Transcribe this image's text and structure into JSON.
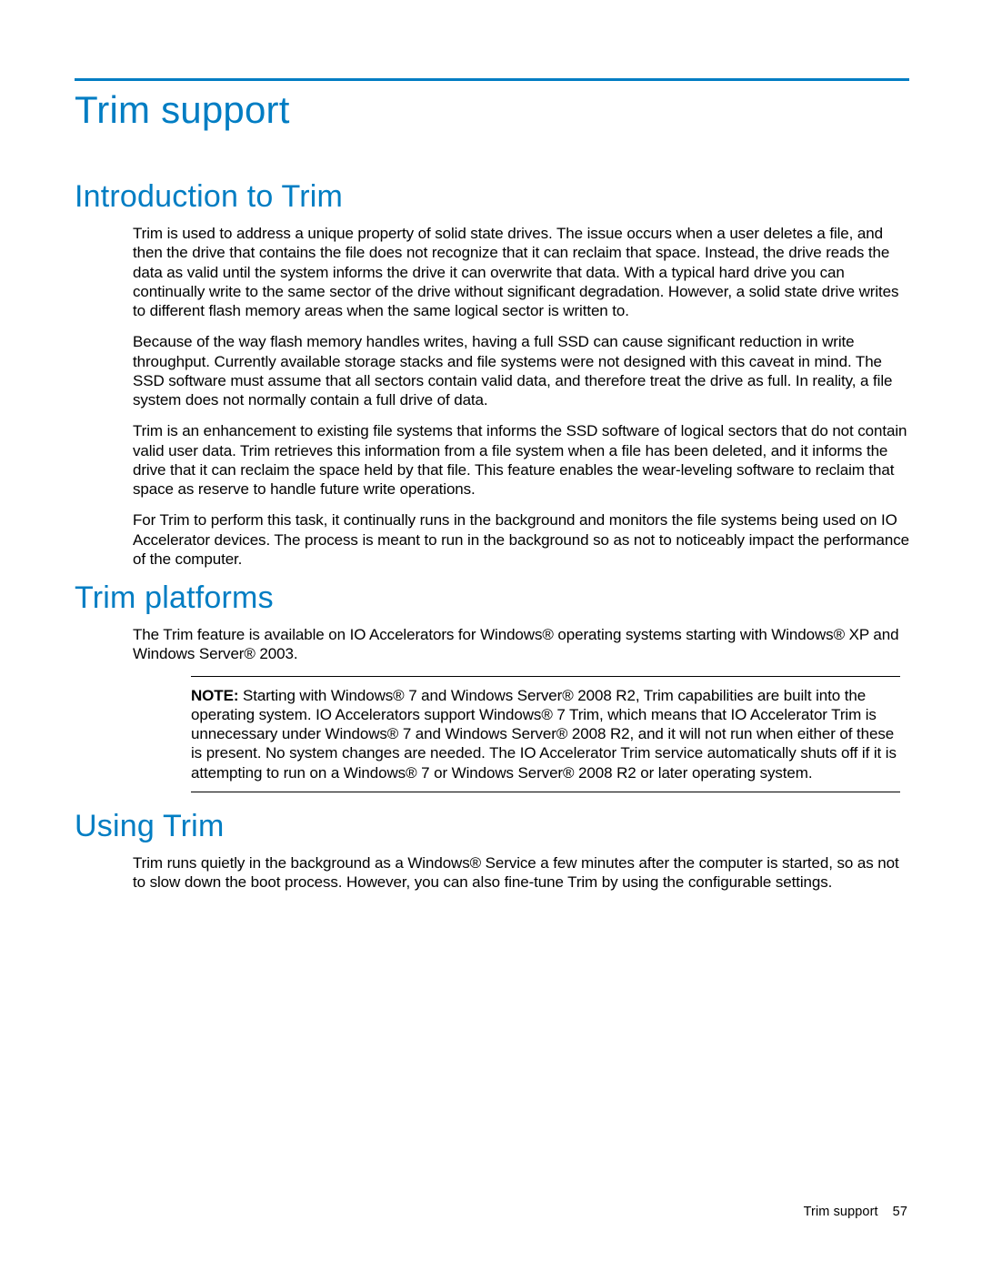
{
  "chapter": {
    "title": "Trim support"
  },
  "sections": {
    "intro": {
      "heading": "Introduction to Trim",
      "p1": "Trim is used to address a unique property of solid state drives. The issue occurs when a user deletes a file, and then the drive that contains the file does not recognize that it can reclaim that space. Instead, the drive reads the data as valid until the system informs the drive it can overwrite that data. With a typical hard drive you can continually write to the same sector of the drive without significant degradation. However, a solid state drive writes to different flash memory areas when the same logical sector is written to.",
      "p2": "Because of the way flash memory handles writes, having a full SSD can cause significant reduction in write throughput. Currently available storage stacks and file systems were not designed with this caveat in mind. The SSD software must assume that all sectors contain valid data, and therefore treat the drive as full. In reality, a file system does not normally contain a full drive of data.",
      "p3": "Trim is an enhancement to existing file systems that informs the SSD software of logical sectors that do not contain valid user data. Trim retrieves this information from a file system when a file has been deleted, and it informs the drive that it can reclaim the space held by that file. This feature enables the wear-leveling software to reclaim that space as reserve to handle future write operations.",
      "p4": "For Trim to perform this task, it continually runs in the background and monitors the file systems being used on IO Accelerator devices. The process is meant to run in the background so as not to noticeably impact the performance of the computer."
    },
    "platforms": {
      "heading": "Trim platforms",
      "p1": "The Trim feature is available on IO Accelerators for Windows® operating systems starting with Windows® XP and Windows Server® 2003.",
      "note_label": "NOTE:",
      "note_body": "  Starting with Windows® 7 and Windows Server® 2008 R2, Trim capabilities are built into the operating system. IO Accelerators support Windows® 7 Trim, which means that IO Accelerator Trim is unnecessary under Windows® 7 and Windows Server® 2008 R2, and it will not run when either of these is present. No system changes are needed. The IO Accelerator Trim service automatically shuts off if it is attempting to run on a Windows® 7 or Windows Server® 2008 R2 or later operating system."
    },
    "using": {
      "heading": "Using Trim",
      "p1": "Trim runs quietly in the background as a Windows® Service a few minutes after the computer is started, so as not to slow down the boot process. However, you can also fine-tune Trim by using the configurable settings."
    }
  },
  "footer": {
    "text": "Trim support",
    "page": "57"
  }
}
